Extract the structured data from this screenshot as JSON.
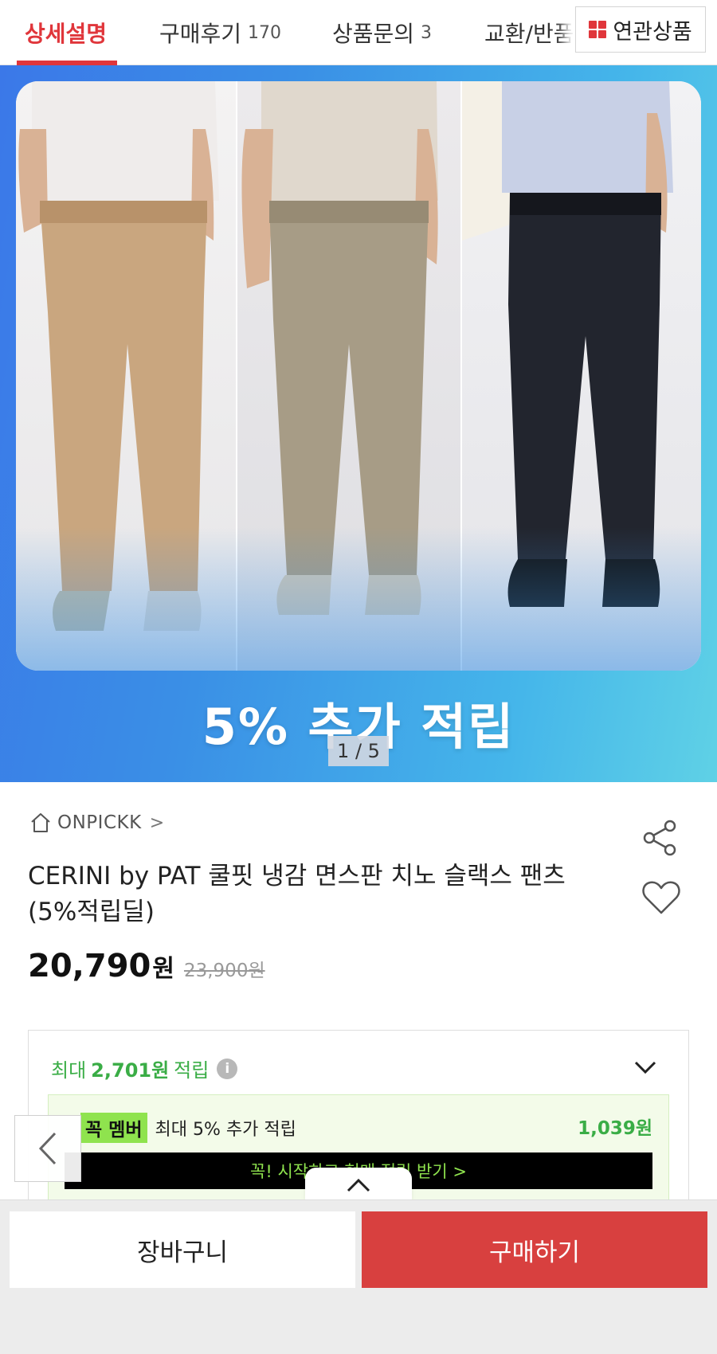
{
  "tabs": [
    {
      "label": "상세설명",
      "count": "",
      "active": true
    },
    {
      "label": "구매후기",
      "count": "170",
      "active": false
    },
    {
      "label": "상품문의",
      "count": "3",
      "active": false
    },
    {
      "label": "교환/반품",
      "count": "",
      "active": false
    }
  ],
  "related_button": {
    "label": "연관상품",
    "icon": "grid-icon"
  },
  "hero": {
    "banner_text": "5% 추가 적립",
    "pager": "1 / 5",
    "pant_colors": [
      "#c9a67f",
      "#a79c86",
      "#22252e"
    ]
  },
  "product": {
    "brand": "ONPICKK",
    "brand_chevron": ">",
    "title": "CERINI by PAT 쿨핏 냉감 면스판 치노 슬랙스 팬츠 (5%적립딜)",
    "price": "20,790",
    "currency": "원",
    "original_price": "23,900원"
  },
  "reward": {
    "prefix": "최대",
    "amount": "2,701원",
    "suffix": "적립",
    "info": "i",
    "member_badge": "꼭 멤버",
    "member_text": "최대 5% 추가 적립",
    "member_amount": "1,039원",
    "member_cta": "꼭! 시작하고 현매 적립 받기 >"
  },
  "bottom": {
    "cart_label": "장바구니",
    "buy_label": "구매하기"
  },
  "colors": {
    "accent": "#e0363b",
    "buy": "#d8403f",
    "green": "#3aad46",
    "lime": "#8fe34e"
  }
}
